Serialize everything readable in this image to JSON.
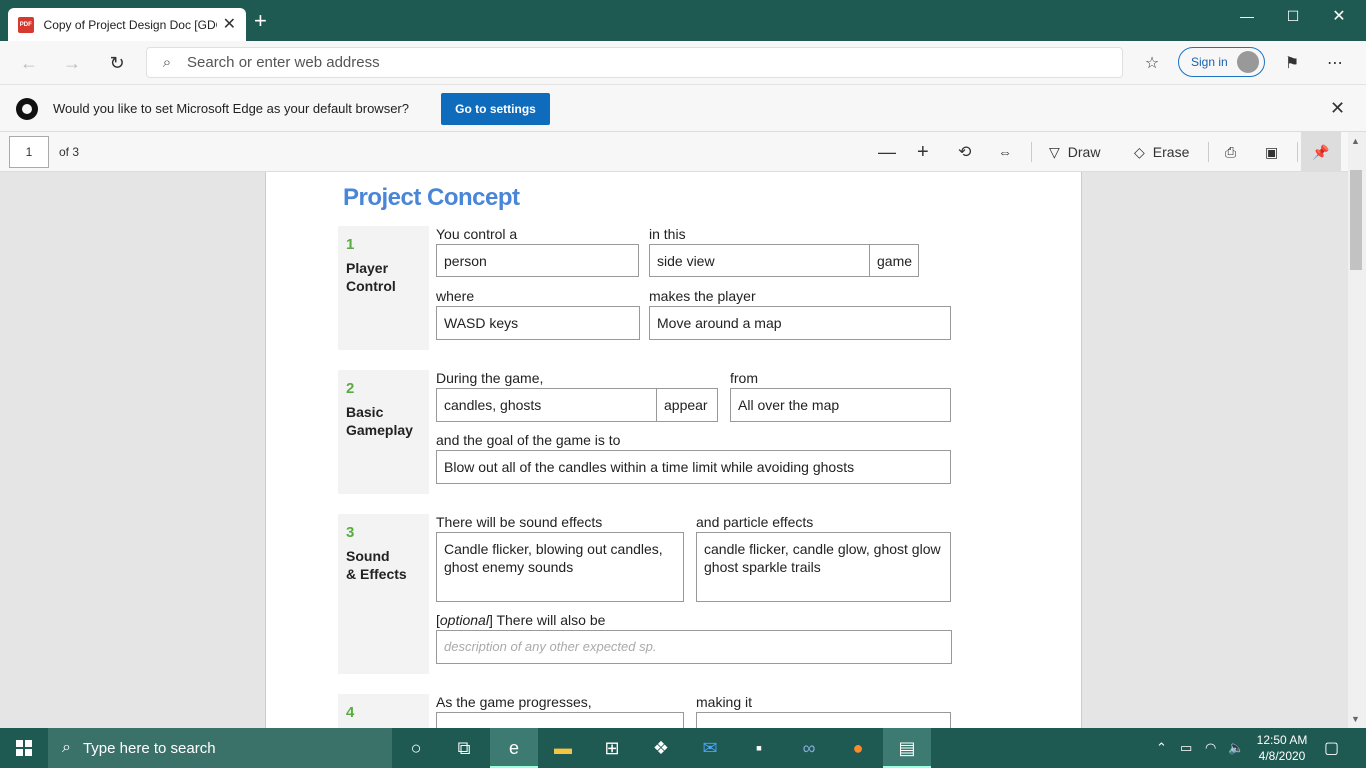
{
  "browser": {
    "tab_title": "Copy of Project Design Doc [GDC",
    "tab_favicon_text": "PDF",
    "address_placeholder": "Search or enter web address",
    "sign_in_label": "Sign in",
    "infobar_text": "Would you like to set Microsoft Edge as your default browser?",
    "infobar_button": "Go to settings"
  },
  "pdf_toolbar": {
    "page_number": "1",
    "page_of": "of 3",
    "draw_label": "Draw",
    "erase_label": "Erase"
  },
  "doc": {
    "title": "Project Concept",
    "sections": [
      {
        "num": "1",
        "name_line1": "Player",
        "name_line2": "Control"
      },
      {
        "num": "2",
        "name_line1": "Basic",
        "name_line2": "Gameplay"
      },
      {
        "num": "3",
        "name_line1": "Sound",
        "name_line2": "& Effects"
      },
      {
        "num": "4"
      }
    ],
    "s1": {
      "lbl_control": "You control a",
      "val_control": "person",
      "lbl_in_this": "in this",
      "val_view": "side view",
      "suffix_game": "game",
      "lbl_where": "where",
      "val_where": "WASD keys",
      "lbl_makes": "makes the player",
      "val_makes": "Move around a map"
    },
    "s2": {
      "lbl_during": "During the game,",
      "val_during": "candles, ghosts",
      "suffix_appear": "appear",
      "lbl_from": "from",
      "val_from": "All over the map",
      "lbl_goal": "and the goal of the game is to",
      "val_goal": "Blow out all of the candles within a time limit while avoiding ghosts"
    },
    "s3": {
      "lbl_sound": "There will be sound effects",
      "val_sound": "Candle flicker, blowing out candles, ghost enemy sounds",
      "lbl_particle": "and particle effects",
      "val_particle": "candle flicker, candle glow, ghost glow ghost sparkle trails",
      "lbl_optional_tag": "optional",
      "lbl_optional_rest": "There will also be",
      "val_optional_placeholder": "description of any other expected sp."
    },
    "s4": {
      "lbl_progress": "As the game progresses,",
      "lbl_making": "making it"
    }
  },
  "taskbar": {
    "search_placeholder": "Type here to search",
    "time": "12:50 AM",
    "date": "4/8/2020"
  },
  "colors": {
    "title_bar": "#1f5a52",
    "doc_title": "#4a86d8",
    "section_number": "#5aac42",
    "infobar_button": "#0f6cbd"
  }
}
